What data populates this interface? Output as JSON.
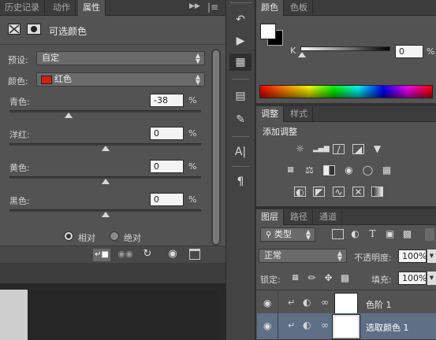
{
  "properties_panel": {
    "tabs": [
      "历史记录",
      "动作",
      "属性"
    ],
    "title": "可选颜色",
    "preset_label": "预设:",
    "preset_value": "自定",
    "colors_label": "颜色:",
    "colors_value": "红色",
    "colors_swatch": "#d3210e",
    "sliders": [
      {
        "label": "青色:",
        "value": "-38",
        "unit": "%",
        "level": -38
      },
      {
        "label": "洋红:",
        "value": "0",
        "unit": "%",
        "level": 0
      },
      {
        "label": "黄色:",
        "value": "0",
        "unit": "%",
        "level": 0
      },
      {
        "label": "黑色:",
        "value": "0",
        "unit": "%",
        "level": 0
      }
    ],
    "method_relative": "相对",
    "method_absolute": "绝对"
  },
  "color_panel": {
    "tabs": [
      "颜色",
      "色板"
    ],
    "k_label": "K",
    "k_value": "0",
    "k_unit": "%"
  },
  "adjustments_panel": {
    "tabs": [
      "调整",
      "样式"
    ],
    "title": "添加调整"
  },
  "layers_panel": {
    "tabs": [
      "图层",
      "路径",
      "通道"
    ],
    "filter_value": "类型",
    "blend_mode": "正常",
    "opacity_label": "不透明度:",
    "opacity_value": "100%",
    "lock_label": "锁定:",
    "fill_label": "填充:",
    "fill_value": "100%",
    "layers": [
      {
        "name": "色阶 1",
        "selected": false
      },
      {
        "name": "选取颜色 1",
        "selected": true
      }
    ]
  },
  "colors": {
    "panel_bg": "#535353",
    "dark_bg": "#323232",
    "selected_layer": "#5e6f86"
  }
}
